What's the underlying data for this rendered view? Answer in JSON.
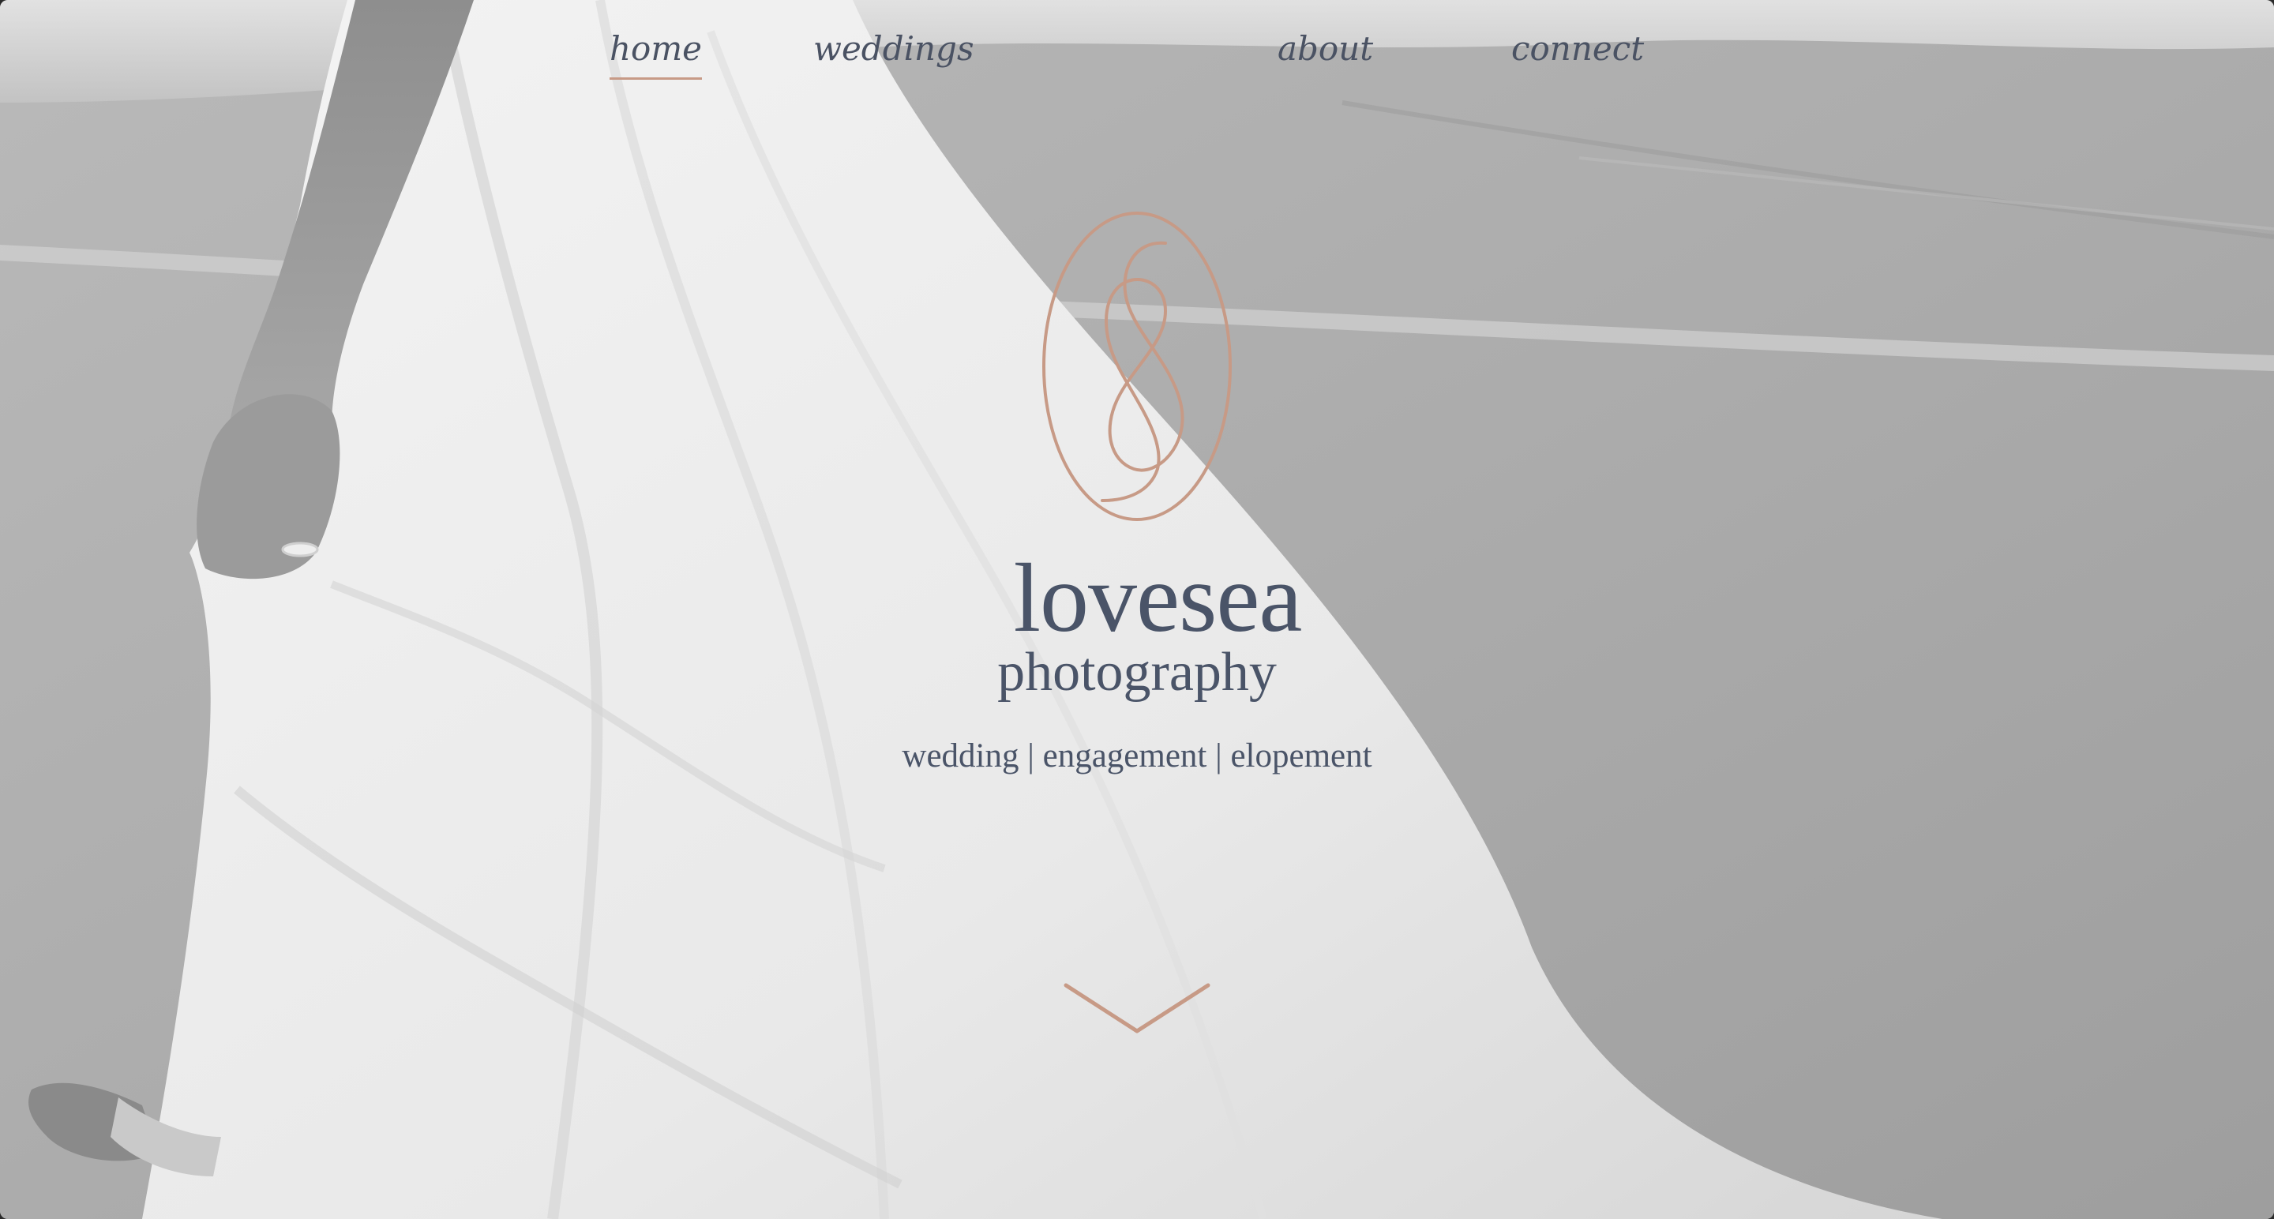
{
  "nav": {
    "items": [
      {
        "label": "home",
        "active": true
      },
      {
        "label": "weddings",
        "active": false
      },
      {
        "label": "about",
        "active": false
      },
      {
        "label": "connect",
        "active": false
      }
    ]
  },
  "brand": {
    "name": "lovesea",
    "subtitle": "photography",
    "logo_icon": "infinity-knot-oval-logo"
  },
  "hero": {
    "tagline": "wedding | engagement | elopement",
    "scroll_icon": "chevron-down-icon",
    "photo_subject": "bride-in-flowing-dress-on-beach"
  },
  "colors": {
    "accent": "#c79a86",
    "text": "#4a5468",
    "active_underline": "#c79a86"
  }
}
